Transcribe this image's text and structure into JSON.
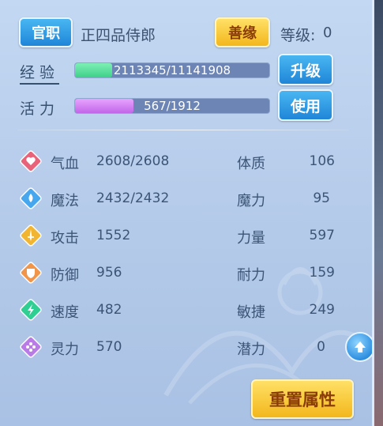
{
  "header": {
    "title_button": "官职",
    "rank": "正四品侍郎",
    "karma_button": "善缘",
    "level_label": "等级:",
    "level_value": "0"
  },
  "exp": {
    "label": "经验",
    "value": "2113345/11141908",
    "fraction": 0.19,
    "button": "升级",
    "fill_color": "#3fd08a"
  },
  "vitality": {
    "label": "活力",
    "value": "567/1912",
    "fraction": 0.3,
    "button": "使用",
    "fill_color": "#c266e8"
  },
  "stats_left": [
    {
      "icon": "heart-icon",
      "name": "气血",
      "value": "2608/2608",
      "color": "#e8627a"
    },
    {
      "icon": "droplet-icon",
      "name": "魔法",
      "value": "2432/2432",
      "color": "#46a7ef"
    },
    {
      "icon": "sword-icon",
      "name": "攻击",
      "value": "1552",
      "color": "#f2b531"
    },
    {
      "icon": "shield-icon",
      "name": "防御",
      "value": "956",
      "color": "#f0954a"
    },
    {
      "icon": "lightning-icon",
      "name": "速度",
      "value": "482",
      "color": "#2fcf93"
    },
    {
      "icon": "sparkle-icon",
      "name": "灵力",
      "value": "570",
      "color": "#b97be6"
    }
  ],
  "stats_right": [
    {
      "name": "体质",
      "value": "106"
    },
    {
      "name": "魔力",
      "value": "95"
    },
    {
      "name": "力量",
      "value": "597"
    },
    {
      "name": "耐力",
      "value": "159"
    },
    {
      "name": "敏捷",
      "value": "249"
    },
    {
      "name": "潜力",
      "value": "0"
    }
  ],
  "reset_button": "重置属性",
  "scroll_up_icon": "arrow-up-icon"
}
